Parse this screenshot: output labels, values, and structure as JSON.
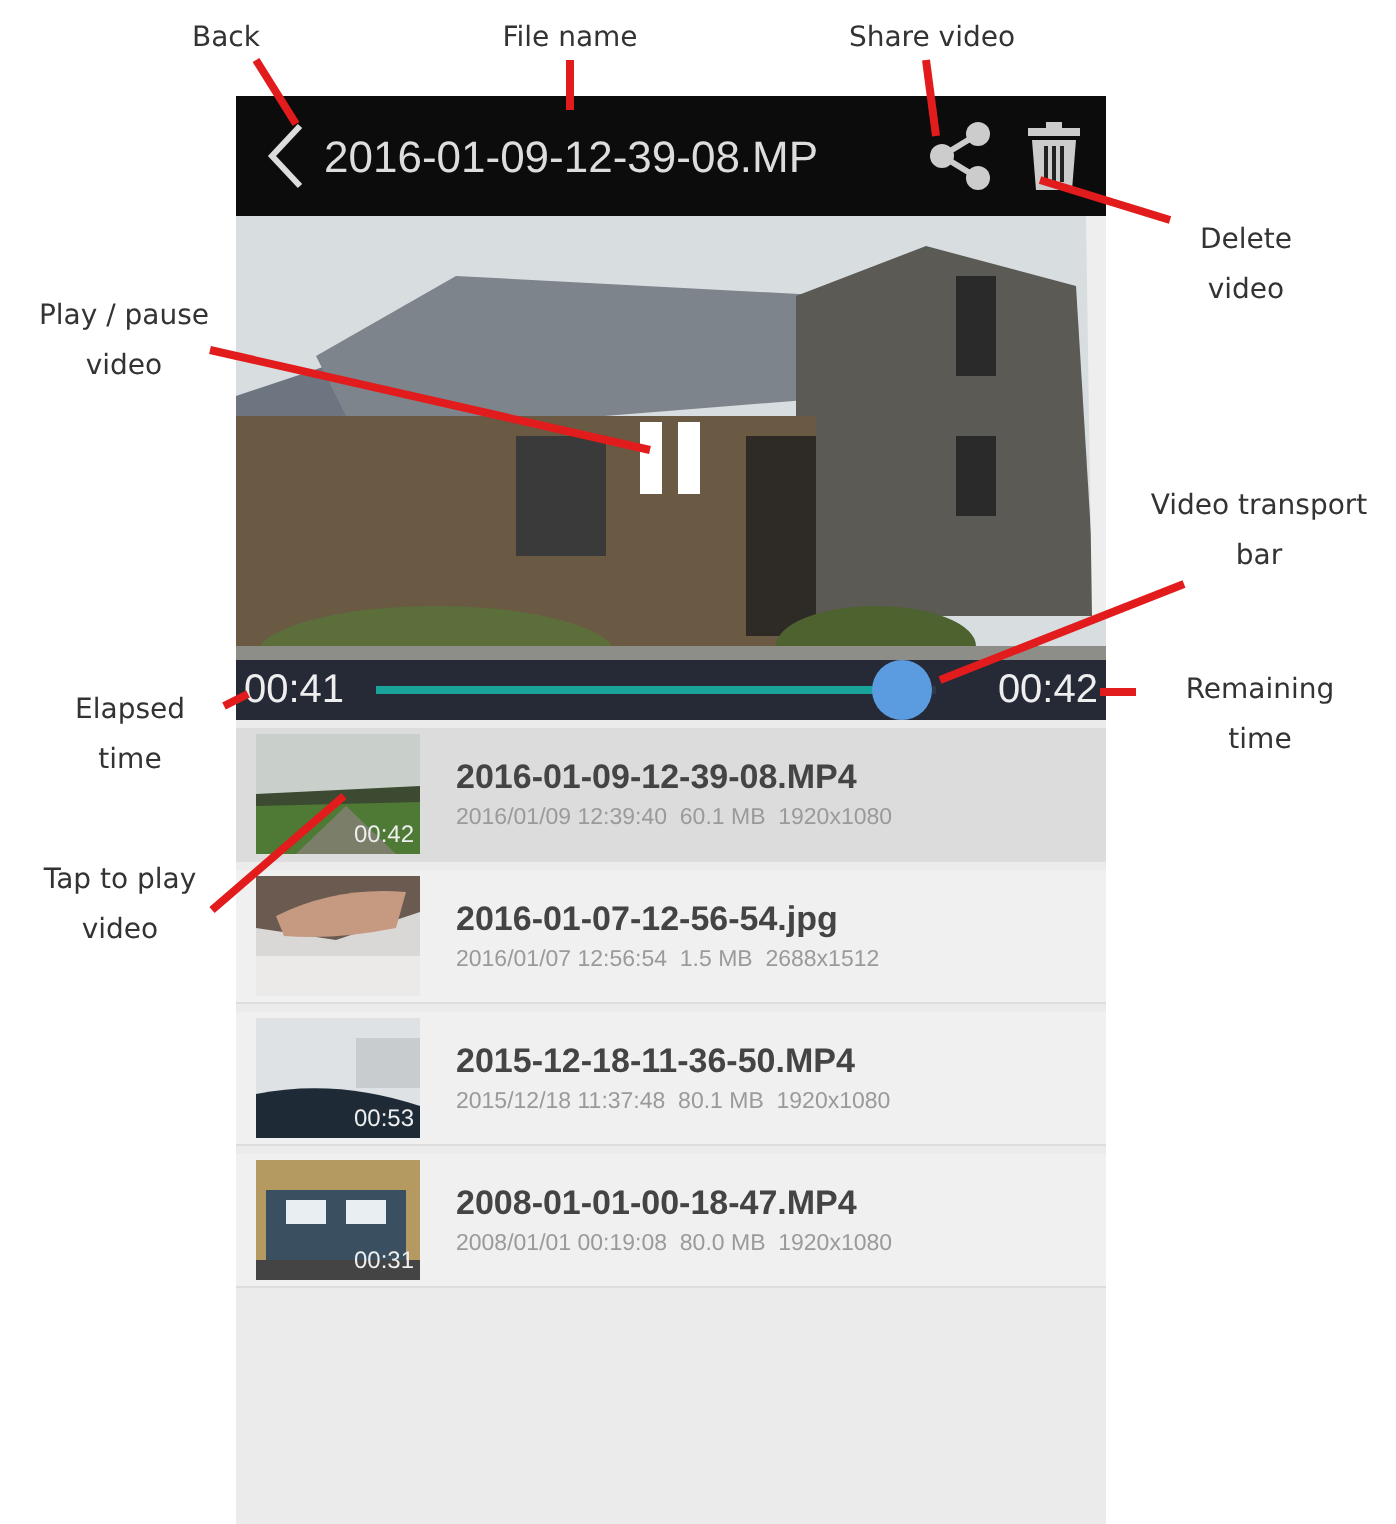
{
  "annotations": [
    {
      "text": "Back"
    },
    {
      "text": "File name"
    },
    {
      "text": "Share video"
    },
    {
      "text": "Delete video"
    },
    {
      "text": "Play / pause video"
    },
    {
      "text": "Video transport bar"
    },
    {
      "text": "Elapsed time"
    },
    {
      "text": "Remaining time"
    },
    {
      "text": "Tap to play video"
    }
  ],
  "header": {
    "file_name": "2016-01-09-12-39-08.MP"
  },
  "player": {
    "playing": true,
    "elapsed": "00:41",
    "remaining": "00:42",
    "level": 0.94
  },
  "files": [
    {
      "name": "2016-01-09-12-39-08.MP4",
      "meta": "2016/01/09 12:39:40  60.1 MB  1920x1080",
      "duration": "00:42",
      "selected": true
    },
    {
      "name": "2016-01-07-12-56-54.jpg",
      "meta": "2016/01/07 12:56:54  1.5 MB  2688x1512",
      "selected": false
    },
    {
      "name": "2015-12-18-11-36-50.MP4",
      "meta": "2015/12/18 11:37:48  80.1 MB  1920x1080",
      "duration": "00:53",
      "selected": false
    },
    {
      "name": "2008-01-01-00-18-47.MP4",
      "meta": "2008/01/01 00:19:08  80.0 MB  1920x1080",
      "duration": "00:31",
      "selected": false
    }
  ]
}
